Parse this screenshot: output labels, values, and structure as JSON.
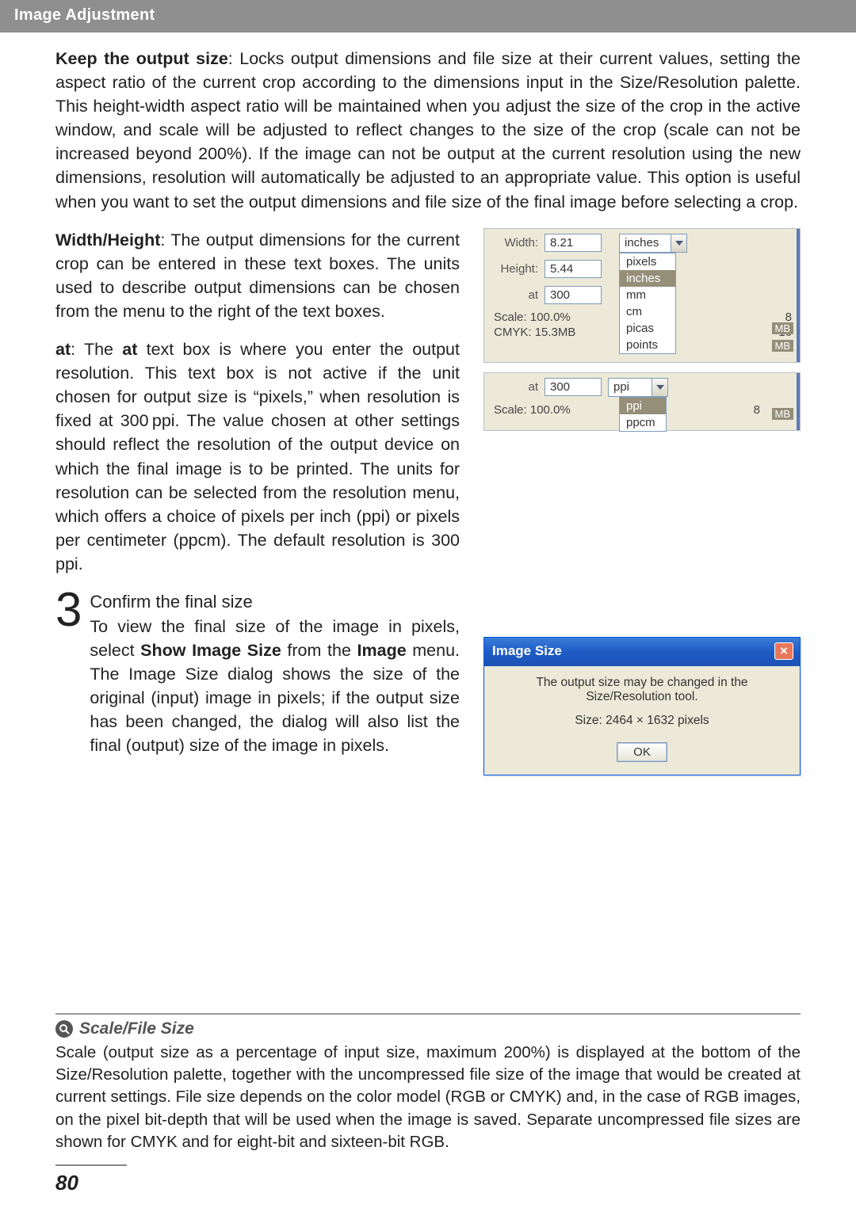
{
  "section_header": "Image Adjustment",
  "p_keep": {
    "lead": "Keep the output size",
    "rest": ": Locks output dimensions and file size at their current values, setting the aspect ratio of the current crop according to the dimensions input in the Size/Resolution palette. This height-width aspect ratio will be maintained when you adjust the size of the crop in the active window, and scale will be adjusted to reflect changes to the size of the crop (scale can not be increased beyond 200%). If the image can not be output at the current resolution using the new dimensions, resolution will automatically be adjusted to an appropriate value. This option is useful when you want to set the output dimensions and file size of the final image before selecting a crop."
  },
  "p_wh": {
    "lead": "Width/Height",
    "rest": ": The output dimensions for the current crop can be entered in these text boxes. The units used to describe output dimensions can be chosen from the menu to the right of the text boxes."
  },
  "p_at": {
    "lead": "at",
    "mid1": ": The ",
    "bold2": "at",
    "rest": " text box is where you enter the output resolution. This text box is not active if the unit chosen for output size is “pixels,” when resolution is fixed at 300 ppi. The value chosen at other settings should reflect the resolution of the output device on which the final image is to be printed. The units for resolution can be selected from the resolution menu, which offers a choice of pixels per inch (ppi) or pixels per centimeter (ppcm). The default resolution is 300 ppi."
  },
  "step3": {
    "num": "3",
    "title": "Confirm the final size",
    "a": "To view the final size of the image in pixels, select ",
    "b1": "Show Image Size",
    "c": " from the ",
    "b2": "Image",
    "d": " menu. The Image Size dialog shows the size of the original (input) image in pixels; if the output size has been changed, the dialog will also list the final (output) size of the image in pixels."
  },
  "panel1": {
    "width_lbl": "Width:",
    "width_val": "8.21",
    "height_lbl": "Height:",
    "height_val": "5.44",
    "at_lbl": "at",
    "at_val": "300",
    "unit_selected": "inches",
    "unit_options": [
      "pixels",
      "inches",
      "mm",
      "cm",
      "picas",
      "points"
    ],
    "scale_lbl": "Scale:",
    "scale_val": "100.0%",
    "cmyk_lbl": "CMYK:",
    "cmyk_val": "15.3MB",
    "eight": "8",
    "sixteen": "16",
    "mb": "MB"
  },
  "panel2": {
    "at_lbl": "at",
    "at_val": "300",
    "res_selected": "ppi",
    "res_options": [
      "ppi",
      "ppcm"
    ],
    "scale_lbl": "Scale:",
    "scale_val": "100.0%",
    "eight": "8",
    "mb": "MB"
  },
  "dialog": {
    "title": "Image Size",
    "close": "×",
    "msg": "The output size may be changed in the Size/Resolution tool.",
    "size_lbl": "Size:",
    "size_val": "2464 × 1632 pixels",
    "ok": "OK"
  },
  "note": {
    "title": "Scale/File Size",
    "text": "Scale (output size as a percentage of input size, maximum 200%) is displayed at the bottom of the Size/Resolution palette, together with the uncompressed file size of the image that would be created at current settings. File size depends on the color model (RGB or CMYK) and, in the case of RGB images, on the pixel bit-depth that will be used when the image is saved. Separate uncompressed file sizes are shown for CMYK and for eight-bit and sixteen-bit RGB."
  },
  "page_number": "80"
}
